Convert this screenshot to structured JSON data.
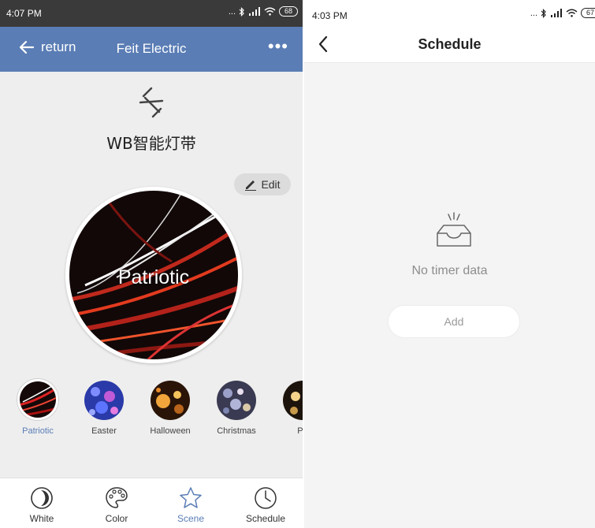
{
  "left_screen": {
    "status_bar": {
      "time": "4:07 PM",
      "dots": "...",
      "battery": "68"
    },
    "app_bar": {
      "back_label": "return",
      "title": "Feit Electric",
      "more": "•••"
    },
    "device_name": "WB智能灯带",
    "edit_label": "Edit",
    "current_scene": "Patriotic",
    "scenes": [
      {
        "label": "Patriotic",
        "selected": true
      },
      {
        "label": "Easter"
      },
      {
        "label": "Halloween"
      },
      {
        "label": "Christmas"
      },
      {
        "label": "Pa"
      }
    ],
    "tabs": [
      {
        "label": "White",
        "icon": "moon-icon"
      },
      {
        "label": "Color",
        "icon": "palette-icon"
      },
      {
        "label": "Scene",
        "icon": "star-icon",
        "active": true
      },
      {
        "label": "Schedule",
        "icon": "clock-icon"
      }
    ],
    "colors": {
      "accent": "#5a7db5",
      "header": "#5a7db5",
      "status_bar": "#3a3a3a"
    }
  },
  "right_screen": {
    "status_bar": {
      "time": "4:03 PM",
      "dots": "...",
      "battery": "67"
    },
    "title": "Schedule",
    "empty_message": "No timer data",
    "add_label": "Add"
  }
}
